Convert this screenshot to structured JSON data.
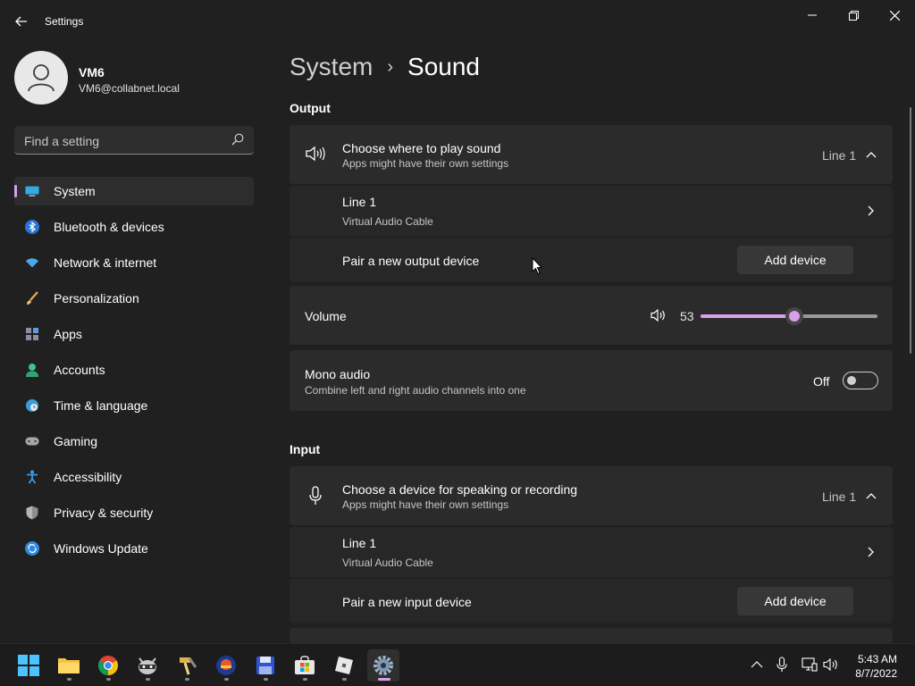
{
  "window": {
    "app_title": "Settings"
  },
  "profile": {
    "name": "VM6",
    "email": "VM6@collabnet.local"
  },
  "search": {
    "placeholder": "Find a setting"
  },
  "nav": {
    "items": [
      {
        "label": "System",
        "icon": "system-icon",
        "selected": true
      },
      {
        "label": "Bluetooth & devices",
        "icon": "bluetooth-icon"
      },
      {
        "label": "Network & internet",
        "icon": "wifi-icon"
      },
      {
        "label": "Personalization",
        "icon": "brush-icon"
      },
      {
        "label": "Apps",
        "icon": "apps-icon"
      },
      {
        "label": "Accounts",
        "icon": "accounts-icon"
      },
      {
        "label": "Time & language",
        "icon": "clock-globe-icon"
      },
      {
        "label": "Gaming",
        "icon": "gamepad-icon"
      },
      {
        "label": "Accessibility",
        "icon": "accessibility-icon"
      },
      {
        "label": "Privacy & security",
        "icon": "shield-icon"
      },
      {
        "label": "Windows Update",
        "icon": "update-icon"
      }
    ]
  },
  "breadcrumb": {
    "parent": "System",
    "separator": "›",
    "current": "Sound"
  },
  "output": {
    "section_title": "Output",
    "choose_title": "Choose where to play sound",
    "choose_sub": "Apps might have their own settings",
    "choose_value": "Line 1",
    "device_name": "Line 1",
    "device_sub": "Virtual Audio Cable",
    "pair_label": "Pair a new output device",
    "add_button": "Add device"
  },
  "volume": {
    "label": "Volume",
    "value_text": "53",
    "value": 53
  },
  "mono": {
    "title": "Mono audio",
    "sub": "Combine left and right audio channels into one",
    "state": "Off"
  },
  "input": {
    "section_title": "Input",
    "choose_title": "Choose a device for speaking or recording",
    "choose_sub": "Apps might have their own settings",
    "choose_value": "Line 1",
    "device_name": "Line 1",
    "device_sub": "Virtual Audio Cable",
    "pair_label": "Pair a new input device",
    "add_button": "Add device"
  },
  "taskbar": {
    "apps": [
      "start-icon",
      "file-explorer-icon",
      "chrome-icon",
      "raccoon-app-icon",
      "tool-app-icon",
      "ai-app-icon",
      "save-app-icon",
      "store-icon",
      "roblox-icon",
      "settings-icon"
    ],
    "time": "5:43 AM",
    "date": "8/7/2022"
  },
  "colors": {
    "accent": "#d9a0e8",
    "background": "#202020",
    "card": "#2b2b2b"
  }
}
